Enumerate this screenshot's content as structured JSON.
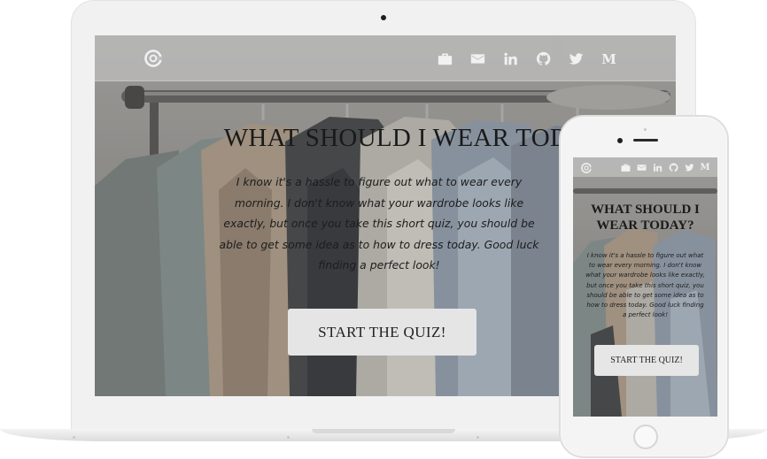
{
  "page": {
    "title": "WHAT SHOULD I WEAR TODAY?",
    "intro": "I know it's a hassle to figure out what to wear every morning. I don't know what your wardrobe looks like exactly, but once you take this short quiz, you should be able to get some idea as to how to dress today. Good luck finding a perfect look!",
    "start_button": "START THE QUIZ!"
  },
  "nav": {
    "logo_icon": "logo-c-icon",
    "icons": [
      "briefcase-icon",
      "envelope-icon",
      "linkedin-icon",
      "github-icon",
      "twitter-icon",
      "medium-icon"
    ],
    "medium_letter": "M"
  },
  "colors": {
    "nav_background": "#bebebe",
    "nav_icon": "#f1f1f1",
    "title_text": "#1a1a1a",
    "button_background": "#e5e5e5",
    "device_frame": "#f1f1f1"
  }
}
